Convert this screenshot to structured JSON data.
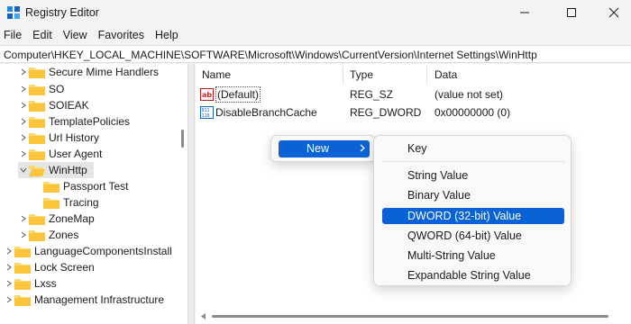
{
  "window": {
    "title": "Registry Editor"
  },
  "menubar": [
    "File",
    "Edit",
    "View",
    "Favorites",
    "Help"
  ],
  "address": "Computer\\HKEY_LOCAL_MACHINE\\SOFTWARE\\Microsoft\\Windows\\CurrentVersion\\Internet Settings\\WinHttp",
  "tree": {
    "items": [
      {
        "label": "Secure Mime Handlers"
      },
      {
        "label": "SO"
      },
      {
        "label": "SOIEAK"
      },
      {
        "label": "TemplatePolicies"
      },
      {
        "label": "Url History"
      },
      {
        "label": "User Agent"
      },
      {
        "label": "WinHttp"
      },
      {
        "label": "Passport Test"
      },
      {
        "label": "Tracing"
      },
      {
        "label": "ZoneMap"
      },
      {
        "label": "Zones"
      },
      {
        "label": "LanguageComponentsInstall"
      },
      {
        "label": "Lock Screen"
      },
      {
        "label": "Lxss"
      },
      {
        "label": "Management Infrastructure"
      }
    ]
  },
  "values": {
    "columns": [
      "Name",
      "Type",
      "Data"
    ],
    "rows": [
      {
        "name": "(Default)",
        "type": "REG_SZ",
        "data": "(value not set)",
        "icon": "string-value-icon"
      },
      {
        "name": "DisableBranchCache",
        "type": "REG_DWORD",
        "data": "0x00000000 (0)",
        "icon": "binary-value-icon"
      }
    ]
  },
  "context_menu": {
    "new_label": "New",
    "submenu": [
      "Key",
      "String Value",
      "Binary Value",
      "DWORD (32-bit) Value",
      "QWORD (64-bit) Value",
      "Multi-String Value",
      "Expandable String Value"
    ]
  },
  "colors": {
    "accent": "#0a63d6",
    "folder": "#f8d775",
    "selection": "#e5e5e5"
  }
}
